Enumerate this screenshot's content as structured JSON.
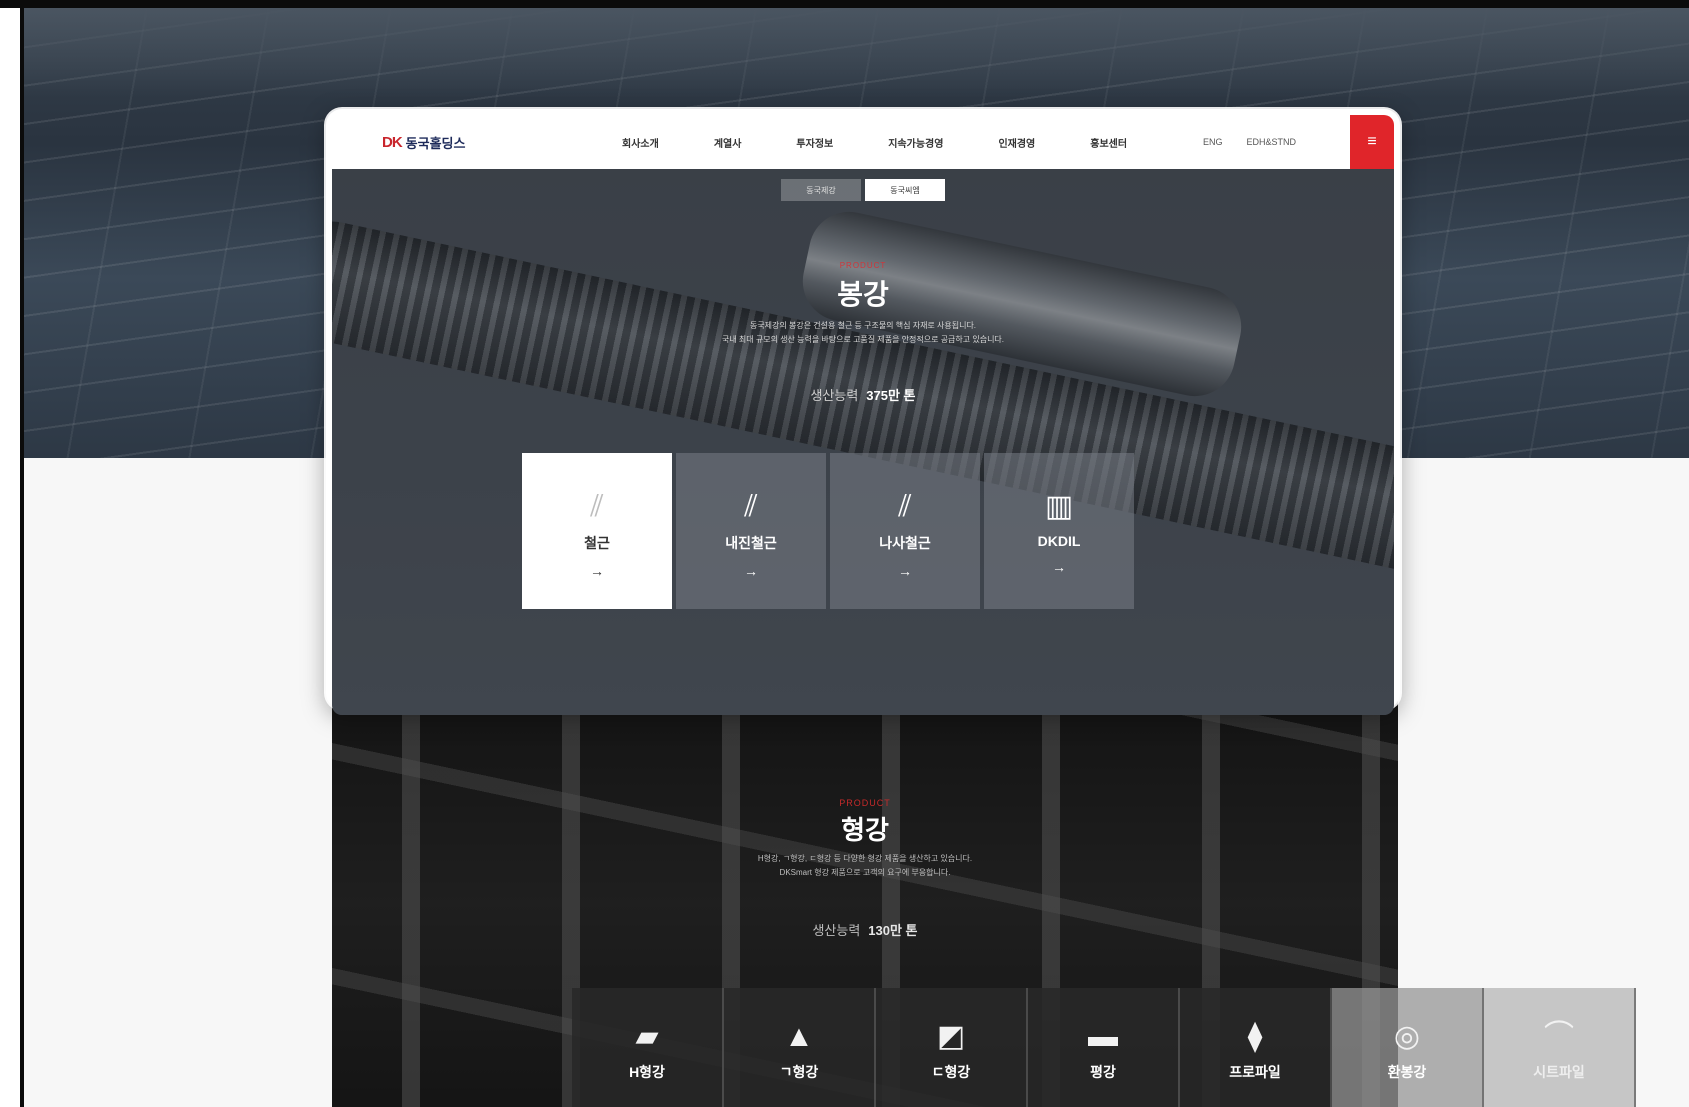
{
  "header": {
    "logo_mark": "DK",
    "logo_text": "동국홀딩스",
    "nav": [
      "회사소개",
      "계열사",
      "투자정보",
      "지속가능경영",
      "인재경영",
      "홍보센터"
    ],
    "lang": [
      "ENG",
      "EDH&STND"
    ],
    "menu_icon": "hamburger-icon"
  },
  "tabs": [
    "동국제강",
    "동국씨엠"
  ],
  "hero": {
    "eyebrow": "PRODUCT",
    "title": "봉강",
    "description_line1": "동국제강의 봉강은 건설용 철근 등 구조물의 핵심 자재로 사용됩니다.",
    "description_line2": "국내 최대 규모의 생산 능력을 바탕으로 고품질 제품을 안정적으로 공급하고 있습니다.",
    "capacity_label": "생산능력",
    "capacity_value": "375만 톤"
  },
  "hero_cards": [
    {
      "label": "철근",
      "icon": "rebar-icon",
      "arrow": "→",
      "active": true
    },
    {
      "label": "내진철근",
      "icon": "seismic-rebar-icon",
      "arrow": "→",
      "active": false
    },
    {
      "label": "나사철근",
      "icon": "screw-rebar-icon",
      "arrow": "→",
      "active": false
    },
    {
      "label": "DKDIL",
      "icon": "coil-icon",
      "arrow": "→",
      "active": false
    }
  ],
  "lower": {
    "eyebrow": "PRODUCT",
    "title": "형강",
    "description_line1": "H형강, ㄱ형강, ㄷ형강 등 다양한 형강 제품을 생산하고 있습니다.",
    "description_line2": "DKSmart 형강 제품으로 고객의 요구에 부응합니다.",
    "capacity_label": "생산능력",
    "capacity_value": "130만 톤"
  },
  "lower_cards": [
    {
      "label": "H형강",
      "icon": "h-beam-icon"
    },
    {
      "label": "ㄱ형강",
      "icon": "angle-steel-icon"
    },
    {
      "label": "ㄷ형강",
      "icon": "channel-steel-icon"
    },
    {
      "label": "평강",
      "icon": "flat-bar-icon"
    },
    {
      "label": "프로파일",
      "icon": "profile-icon"
    },
    {
      "label": "환봉강",
      "icon": "round-bar-icon"
    },
    {
      "label": "시트파일",
      "icon": "sheet-pile-icon"
    }
  ]
}
